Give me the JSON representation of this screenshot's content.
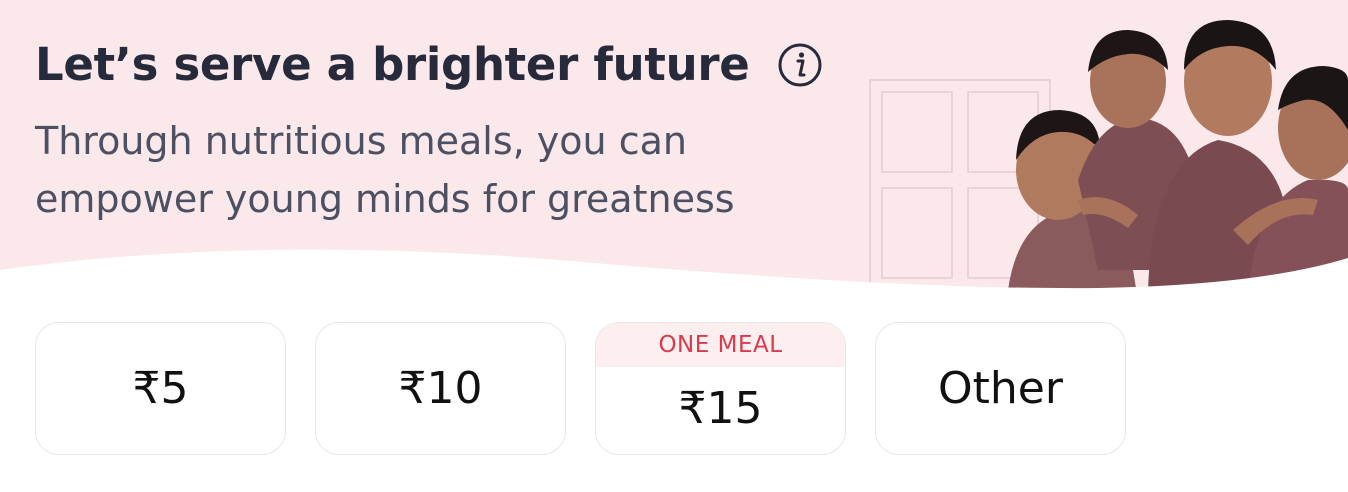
{
  "banner": {
    "title": "Let’s serve a brighter future",
    "subtitle_lines": [
      "Through nutritious meals, you can",
      "empower young minds for greatness"
    ],
    "info_icon": "info-icon",
    "background_color": "#fbe8ea"
  },
  "amounts": [
    {
      "label": "₹5"
    },
    {
      "label": "₹10"
    },
    {
      "label": "₹15",
      "badge": "ONE MEAL"
    },
    {
      "label": "Other"
    }
  ],
  "colors": {
    "title": "#262a3b",
    "subtitle": "#4b5063",
    "badge_text": "#d83a4e",
    "badge_bg": "#fdeef0",
    "button_border": "#e7e7ea"
  }
}
